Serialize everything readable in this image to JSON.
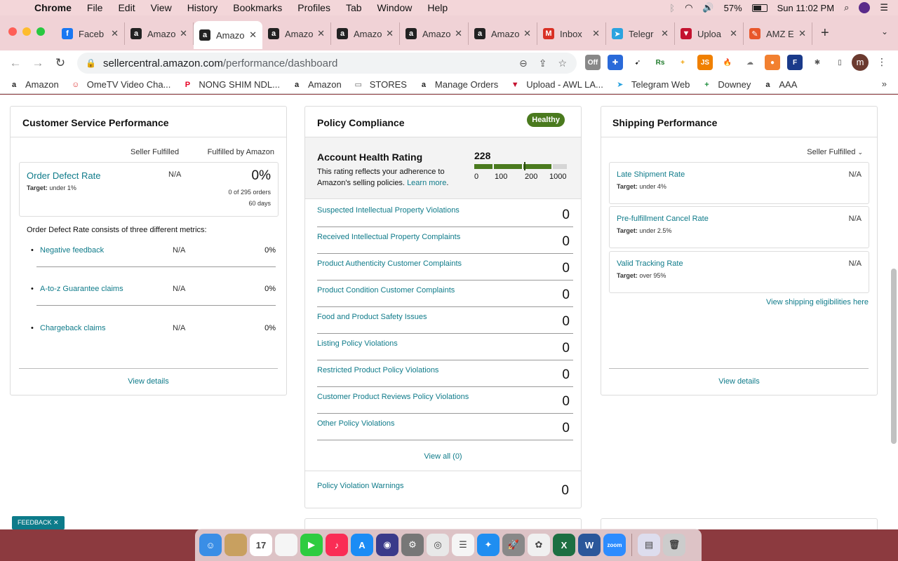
{
  "menubar": {
    "app": "Chrome",
    "items": [
      "File",
      "Edit",
      "View",
      "History",
      "Bookmarks",
      "Profiles",
      "Tab",
      "Window",
      "Help"
    ],
    "battery": "57%",
    "clock": "Sun 11:02 PM"
  },
  "tabs": [
    {
      "title": "Faceb",
      "icon": "f",
      "color": "#1877f2"
    },
    {
      "title": "Amazo",
      "icon": "a",
      "color": "#222"
    },
    {
      "title": "Amazo",
      "icon": "a",
      "color": "#222",
      "active": true
    },
    {
      "title": "Amazo",
      "icon": "a",
      "color": "#222"
    },
    {
      "title": "Amazo",
      "icon": "a",
      "color": "#222"
    },
    {
      "title": "Amazo",
      "icon": "a",
      "color": "#222"
    },
    {
      "title": "Amazo",
      "icon": "a",
      "color": "#222"
    },
    {
      "title": "Inbox",
      "icon": "M",
      "color": "#d93025"
    },
    {
      "title": "Telegr",
      "icon": "➤",
      "color": "#2aa3df"
    },
    {
      "title": "Uploa",
      "icon": "▼",
      "color": "#c4122f"
    },
    {
      "title": "AMZ E",
      "icon": "✎",
      "color": "#e8572a"
    }
  ],
  "address": {
    "host": "sellercentral.amazon.com",
    "path": "/performance/dashboard"
  },
  "bookmarks": [
    {
      "label": "Amazon",
      "icon": "a",
      "color": "#222"
    },
    {
      "label": "OmeTV Video Cha...",
      "icon": "☺",
      "color": "#d33"
    },
    {
      "label": "NONG SHIM NDL...",
      "icon": "P",
      "color": "#e60023"
    },
    {
      "label": "Amazon",
      "icon": "a",
      "color": "#222"
    },
    {
      "label": "STORES",
      "icon": "▭",
      "color": "#666"
    },
    {
      "label": "Manage Orders",
      "icon": "a",
      "color": "#222"
    },
    {
      "label": "Upload - AWL LA...",
      "icon": "▼",
      "color": "#c4122f"
    },
    {
      "label": "Telegram Web",
      "icon": "➤",
      "color": "#2aa3df"
    },
    {
      "label": "Downey",
      "icon": "+",
      "color": "#1e8e3e"
    },
    {
      "label": "AAA",
      "icon": "a",
      "color": "#222"
    }
  ],
  "customer_service": {
    "title": "Customer Service Performance",
    "col_seller": "Seller Fulfilled",
    "col_fba": "Fulfilled by Amazon",
    "odr": {
      "name": "Order Defect Rate",
      "target_label": "Target:",
      "target_value": " under 1%",
      "seller_value": "N/A",
      "fba_value": "0%",
      "orders": "0 of 295 orders",
      "days": "60 days"
    },
    "intro": "Order Defect Rate consists of three different metrics:",
    "metrics": [
      {
        "name": "Negative feedback",
        "seller": "N/A",
        "fba": "0%"
      },
      {
        "name": "A-to-z Guarantee claims",
        "seller": "N/A",
        "fba": "0%"
      },
      {
        "name": "Chargeback claims",
        "seller": "N/A",
        "fba": "0%"
      }
    ],
    "view_details": "View details"
  },
  "policy": {
    "title": "Policy Compliance",
    "badge": "Healthy",
    "ahr_title": "Account Health Rating",
    "ahr_desc": "This rating reflects your adherence to Amazon's selling policies.",
    "learn_more": "Learn more",
    "score": "228",
    "ticks": [
      "0",
      "100",
      "200",
      "1000"
    ],
    "gauge_colors": [
      "#4a7a1e",
      "#4a7a1e",
      "#4a7a1e",
      "#d5d5d5"
    ],
    "violations": [
      {
        "name": "Suspected Intellectual Property Violations",
        "value": "0"
      },
      {
        "name": "Received Intellectual Property Complaints",
        "value": "0"
      },
      {
        "name": "Product Authenticity Customer Complaints",
        "value": "0"
      },
      {
        "name": "Product Condition Customer Complaints",
        "value": "0"
      },
      {
        "name": "Food and Product Safety Issues",
        "value": "0"
      },
      {
        "name": "Listing Policy Violations",
        "value": "0"
      },
      {
        "name": "Restricted Product Policy Violations",
        "value": "0"
      },
      {
        "name": "Customer Product Reviews Policy Violations",
        "value": "0"
      },
      {
        "name": "Other Policy Violations",
        "value": "0"
      }
    ],
    "view_all": "View all (0)",
    "warnings": {
      "name": "Policy Violation Warnings",
      "value": "0"
    }
  },
  "shipping": {
    "title": "Shipping Performance",
    "selector": "Seller Fulfilled",
    "metrics": [
      {
        "name": "Late Shipment Rate",
        "target_label": "Target:",
        "target_value": " under 4%",
        "value": "N/A"
      },
      {
        "name": "Pre-fulfillment Cancel Rate",
        "target_label": "Target:",
        "target_value": " under 2.5%",
        "value": "N/A"
      },
      {
        "name": "Valid Tracking Rate",
        "target_label": "Target:",
        "target_value": " over 95%",
        "value": "N/A"
      }
    ],
    "eligibilities": "View shipping eligibilities here",
    "view_details": "View details"
  },
  "feedback": "FEEDBACK",
  "dock": [
    {
      "name": "finder",
      "color": "#3a8ee6",
      "glyph": "☺"
    },
    {
      "name": "notes-app",
      "color": "#c8a060",
      "glyph": ""
    },
    {
      "name": "calendar",
      "color": "#ffffff",
      "glyph": "17"
    },
    {
      "name": "notes",
      "color": "#f5f5f5",
      "glyph": ""
    },
    {
      "name": "facetime",
      "color": "#2ecc40",
      "glyph": "▶"
    },
    {
      "name": "music",
      "color": "#fa2d55",
      "glyph": "♪"
    },
    {
      "name": "app-store",
      "color": "#1b8cf5",
      "glyph": "A"
    },
    {
      "name": "siri",
      "color": "#3a3a8a",
      "glyph": "◉"
    },
    {
      "name": "system-preferences",
      "color": "#777",
      "glyph": "⚙"
    },
    {
      "name": "chrome",
      "color": "#e8e8e8",
      "glyph": "◎"
    },
    {
      "name": "reminders",
      "color": "#f5f5f5",
      "glyph": "☰"
    },
    {
      "name": "safari",
      "color": "#1f8ef1",
      "glyph": "✦"
    },
    {
      "name": "launchpad",
      "color": "#888",
      "glyph": "🚀"
    },
    {
      "name": "photos",
      "color": "#f0f0f0",
      "glyph": "✿"
    },
    {
      "name": "excel",
      "color": "#1d6f42",
      "glyph": "X"
    },
    {
      "name": "word",
      "color": "#2b579a",
      "glyph": "W"
    },
    {
      "name": "zoom",
      "color": "#2d8cff",
      "glyph": "zoom"
    },
    {
      "name": "preview",
      "color": "#dde",
      "glyph": "▤"
    },
    {
      "name": "trash",
      "color": "#ccc",
      "glyph": "🗑"
    }
  ]
}
